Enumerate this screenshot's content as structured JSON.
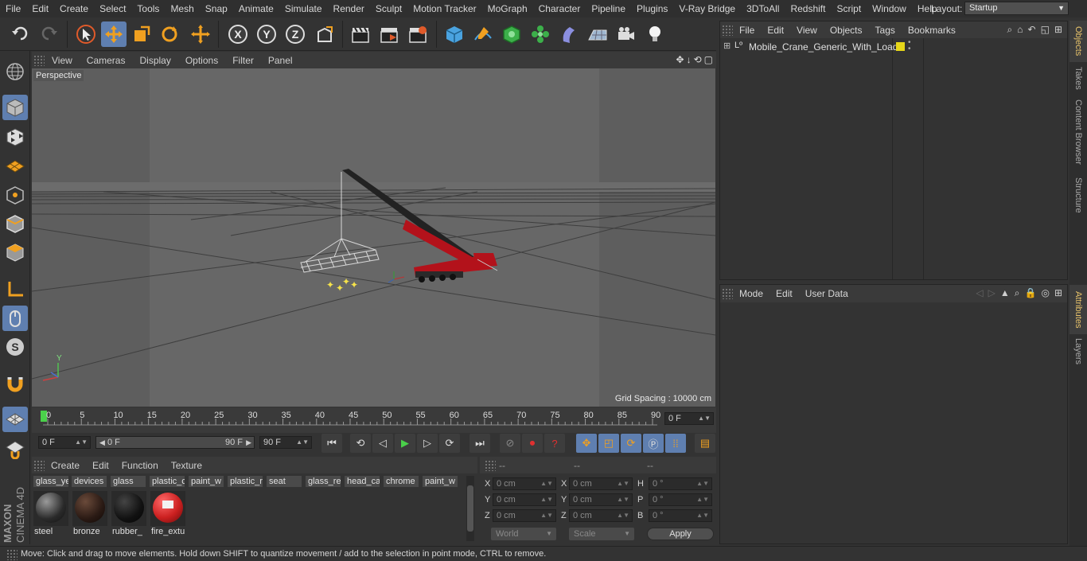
{
  "menubar": {
    "items": [
      "File",
      "Edit",
      "Create",
      "Select",
      "Tools",
      "Mesh",
      "Snap",
      "Animate",
      "Simulate",
      "Render",
      "Sculpt",
      "Motion Tracker",
      "MoGraph",
      "Character",
      "Pipeline",
      "Plugins",
      "V-Ray Bridge",
      "3DToAll",
      "Redshift",
      "Script",
      "Window",
      "Help"
    ],
    "layout_label": "Layout:",
    "layout_value": "Startup"
  },
  "viewport": {
    "menu": [
      "View",
      "Cameras",
      "Display",
      "Options",
      "Filter",
      "Panel"
    ],
    "camera_label": "Perspective",
    "grid_spacing": "Grid Spacing : 10000 cm",
    "axis_y": "Y"
  },
  "timeline": {
    "ticks": [
      "0",
      "5",
      "10",
      "15",
      "20",
      "25",
      "30",
      "35",
      "40",
      "45",
      "50",
      "55",
      "60",
      "65",
      "70",
      "75",
      "80",
      "85",
      "90"
    ],
    "current_frame": "0 F",
    "start_frame": "0 F",
    "range_start": "0 F",
    "range_end": "90 F",
    "end_frame": "90 F"
  },
  "materials": {
    "menu": [
      "Create",
      "Edit",
      "Function",
      "Texture"
    ],
    "tabs": [
      "glass_ye",
      "devices",
      "glass",
      "plastic_c",
      "paint_w",
      "plastic_r",
      "seat",
      "glass_re",
      "head_ca",
      "chrome",
      "paint_w"
    ],
    "balls": [
      {
        "name": "steel",
        "color": "#3a3a3a"
      },
      {
        "name": "bronze",
        "color": "#2a1a14"
      },
      {
        "name": "rubber_",
        "color": "#111111"
      },
      {
        "name": "fire_extu",
        "color": "#cc2020"
      }
    ]
  },
  "coords": {
    "headers": [
      "--",
      "--",
      "--"
    ],
    "rows": [
      {
        "a": "X",
        "av": "0 cm",
        "b": "X",
        "bv": "0 cm",
        "c": "H",
        "cv": "0 °"
      },
      {
        "a": "Y",
        "av": "0 cm",
        "b": "Y",
        "bv": "0 cm",
        "c": "P",
        "cv": "0 °"
      },
      {
        "a": "Z",
        "av": "0 cm",
        "b": "Z",
        "bv": "0 cm",
        "c": "B",
        "cv": "0 °"
      }
    ],
    "space": "World",
    "mode": "Scale",
    "apply": "Apply"
  },
  "objects": {
    "menu": [
      "File",
      "Edit",
      "View",
      "Objects",
      "Tags",
      "Bookmarks"
    ],
    "items": [
      {
        "name": "Mobile_Crane_Generic_With_Load",
        "layer_color": "#e6d619"
      }
    ]
  },
  "attributes": {
    "menu": [
      "Mode",
      "Edit",
      "User Data"
    ]
  },
  "sidetabs": [
    "Objects",
    "Takes",
    "Content Browser",
    "Structure",
    "Attributes",
    "Layers"
  ],
  "brand": {
    "maxon": "MAXON",
    "product": "CINEMA 4D"
  },
  "status": "Move: Click and drag to move elements. Hold down SHIFT to quantize movement / add to the selection in point mode, CTRL to remove.",
  "colors": {
    "accent": "#5f7fb0",
    "crane_red": "#b3121b",
    "highlight_yellow": "#e6d619"
  }
}
